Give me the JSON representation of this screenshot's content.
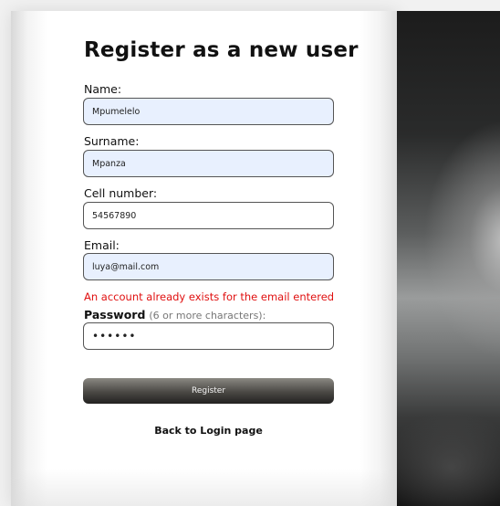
{
  "form": {
    "title": "Register as a new user",
    "name": {
      "label": "Name:",
      "value": "Mpumelelo"
    },
    "surname": {
      "label": "Surname:",
      "value": "Mpanza"
    },
    "cell": {
      "label": "Cell number:",
      "value": "54567890"
    },
    "email": {
      "label": "Email:",
      "value": "luya@mail.com"
    },
    "error_message": "An account already exists for the email entered",
    "password": {
      "label": "Password",
      "hint": "(6 or more characters):",
      "value": "••••••"
    },
    "register_label": "Register",
    "back_link_label": "Back to Login page"
  },
  "colors": {
    "autofill_background": "#e8f0fe",
    "error_text": "#e01010",
    "button_dark": "#2a2927"
  }
}
